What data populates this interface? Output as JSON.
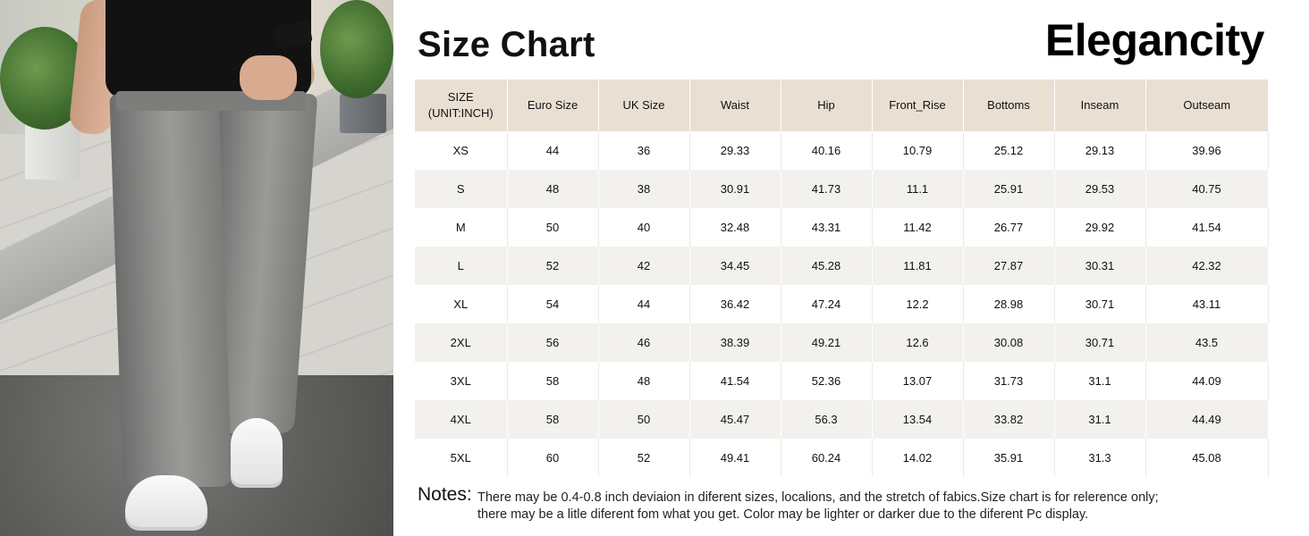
{
  "header": {
    "title": "Size Chart",
    "brand": "Elegancity"
  },
  "product_image": {
    "icon": "model-wearing-gray-jeans-photo"
  },
  "table": {
    "header_bg": "#e9e0d3",
    "stripe_bg": "#f3f1ee",
    "columns": [
      "SIZE\n(UNIT:INCH)",
      "Euro Size",
      "UK Size",
      "Waist",
      "Hip",
      "Front_Rise",
      "Bottoms",
      "Inseam",
      "Outseam"
    ],
    "rows": [
      [
        "XS",
        "44",
        "36",
        "29.33",
        "40.16",
        "10.79",
        "25.12",
        "29.13",
        "39.96"
      ],
      [
        "S",
        "48",
        "38",
        "30.91",
        "41.73",
        "11.1",
        "25.91",
        "29.53",
        "40.75"
      ],
      [
        "M",
        "50",
        "40",
        "32.48",
        "43.31",
        "11.42",
        "26.77",
        "29.92",
        "41.54"
      ],
      [
        "L",
        "52",
        "42",
        "34.45",
        "45.28",
        "11.81",
        "27.87",
        "30.31",
        "42.32"
      ],
      [
        "XL",
        "54",
        "44",
        "36.42",
        "47.24",
        "12.2",
        "28.98",
        "30.71",
        "43.11"
      ],
      [
        "2XL",
        "56",
        "46",
        "38.39",
        "49.21",
        "12.6",
        "30.08",
        "30.71",
        "43.5"
      ],
      [
        "3XL",
        "58",
        "48",
        "41.54",
        "52.36",
        "13.07",
        "31.73",
        "31.1",
        "44.09"
      ],
      [
        "4XL",
        "58",
        "50",
        "45.47",
        "56.3",
        "13.54",
        "33.82",
        "31.1",
        "44.49"
      ],
      [
        "5XL",
        "60",
        "52",
        "49.41",
        "60.24",
        "14.02",
        "35.91",
        "31.3",
        "45.08"
      ]
    ]
  },
  "notes": {
    "label": "Notes:",
    "line1": "There may be 0.4-0.8 inch deviaion in diferent sizes, localions, and the stretch of fabics.Size chart is for relerence only;",
    "line2": "there may be a litle diferent fom what you get. Color may be lighter or darker due to the diferent Pc display."
  }
}
